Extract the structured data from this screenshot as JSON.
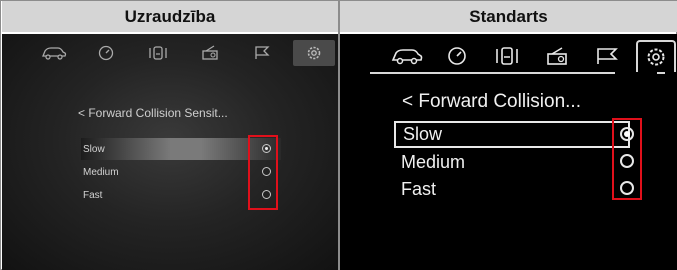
{
  "columns": {
    "left_title": "Uzraudzība",
    "right_title": "Standarts"
  },
  "screens": {
    "left": {
      "icons": [
        "car-icon",
        "gauge-icon",
        "seat-icon",
        "radio-icon",
        "flag-icon",
        "gear-icon"
      ],
      "active_icon": "gear-icon",
      "title": "< Forward Collision Sensit...",
      "options": [
        {
          "label": "Slow",
          "selected": true
        },
        {
          "label": "Medium",
          "selected": false
        },
        {
          "label": "Fast",
          "selected": false
        }
      ]
    },
    "right": {
      "icons": [
        "car-icon",
        "gauge-icon",
        "seat-icon",
        "radio-icon",
        "flag-icon",
        "gear-icon"
      ],
      "active_icon": "gear-icon",
      "title": "<  Forward Collision...",
      "options": [
        {
          "label": "Slow",
          "selected": true
        },
        {
          "label": "Medium",
          "selected": false
        },
        {
          "label": "Fast",
          "selected": false
        }
      ]
    }
  },
  "colors": {
    "highlight_box": "#e0101b",
    "header_bg": "#d5d5d5"
  }
}
